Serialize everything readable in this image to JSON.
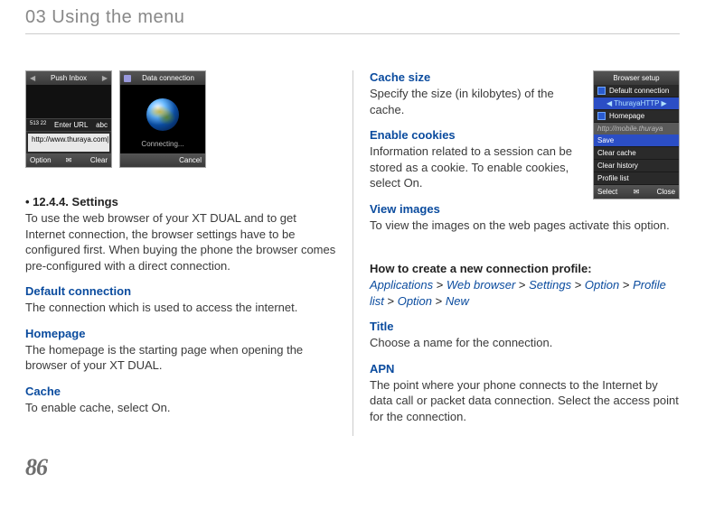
{
  "chapter_title": "03 Using the menu",
  "page_number": "86",
  "left": {
    "shot1": {
      "title": "Push Inbox",
      "enter_url_left": "Enter URL",
      "enter_url_mode": "abc",
      "time": "513 22",
      "url_text": "http://www.thuraya.com|",
      "bottom_left": "Option",
      "bottom_right": "Clear"
    },
    "shot2": {
      "title": "Data connection",
      "connecting": "Connecting...",
      "bottom_right": "Cancel"
    },
    "settings_heading": "• 12.4.4. Settings",
    "settings_para": "To use the web browser of your XT DUAL and to get Internet connection, the browser settings have to be configured first. When buying the phone the browser comes pre-configured with a direct connection.",
    "default_conn_h": "Default connection",
    "default_conn_p": "The connection which is used to access the internet.",
    "homepage_h": "Homepage",
    "homepage_p": "The homepage is the starting page when opening the browser of your XT DUAL.",
    "cache_h": "Cache",
    "cache_p": "To enable cache, select On."
  },
  "right": {
    "browser_setup": {
      "title": "Browser setup",
      "items": [
        "Default connection",
        "ThurayaHTTP",
        "Homepage"
      ],
      "url_gray": "http://mobile.thuraya",
      "menu": [
        "Save",
        "Clear cache",
        "Clear history",
        "Profile list"
      ],
      "bottom_left": "Select",
      "bottom_right": "Close"
    },
    "cache_size_h": "Cache size",
    "cache_size_p": "Specify the size (in kilobytes) of the cache.",
    "cookies_h": "Enable cookies",
    "cookies_p": "Information related to a session can be stored as a cookie. To enable cookies, select On.",
    "view_img_h": "View images",
    "view_img_p": "To view the images on the web pages activate this option.",
    "newprofile_h": "How to create a new connection profile:",
    "breadcrumb": [
      "Applications",
      "Web browser",
      "Settings",
      "Option",
      "Profile list",
      "Option",
      "New"
    ],
    "title_h": "Title",
    "title_p": "Choose a name for the connection.",
    "apn_h": "APN",
    "apn_p": "The point where your phone connects to the Internet by data call or packet data connection. Select the access point for the connection."
  }
}
